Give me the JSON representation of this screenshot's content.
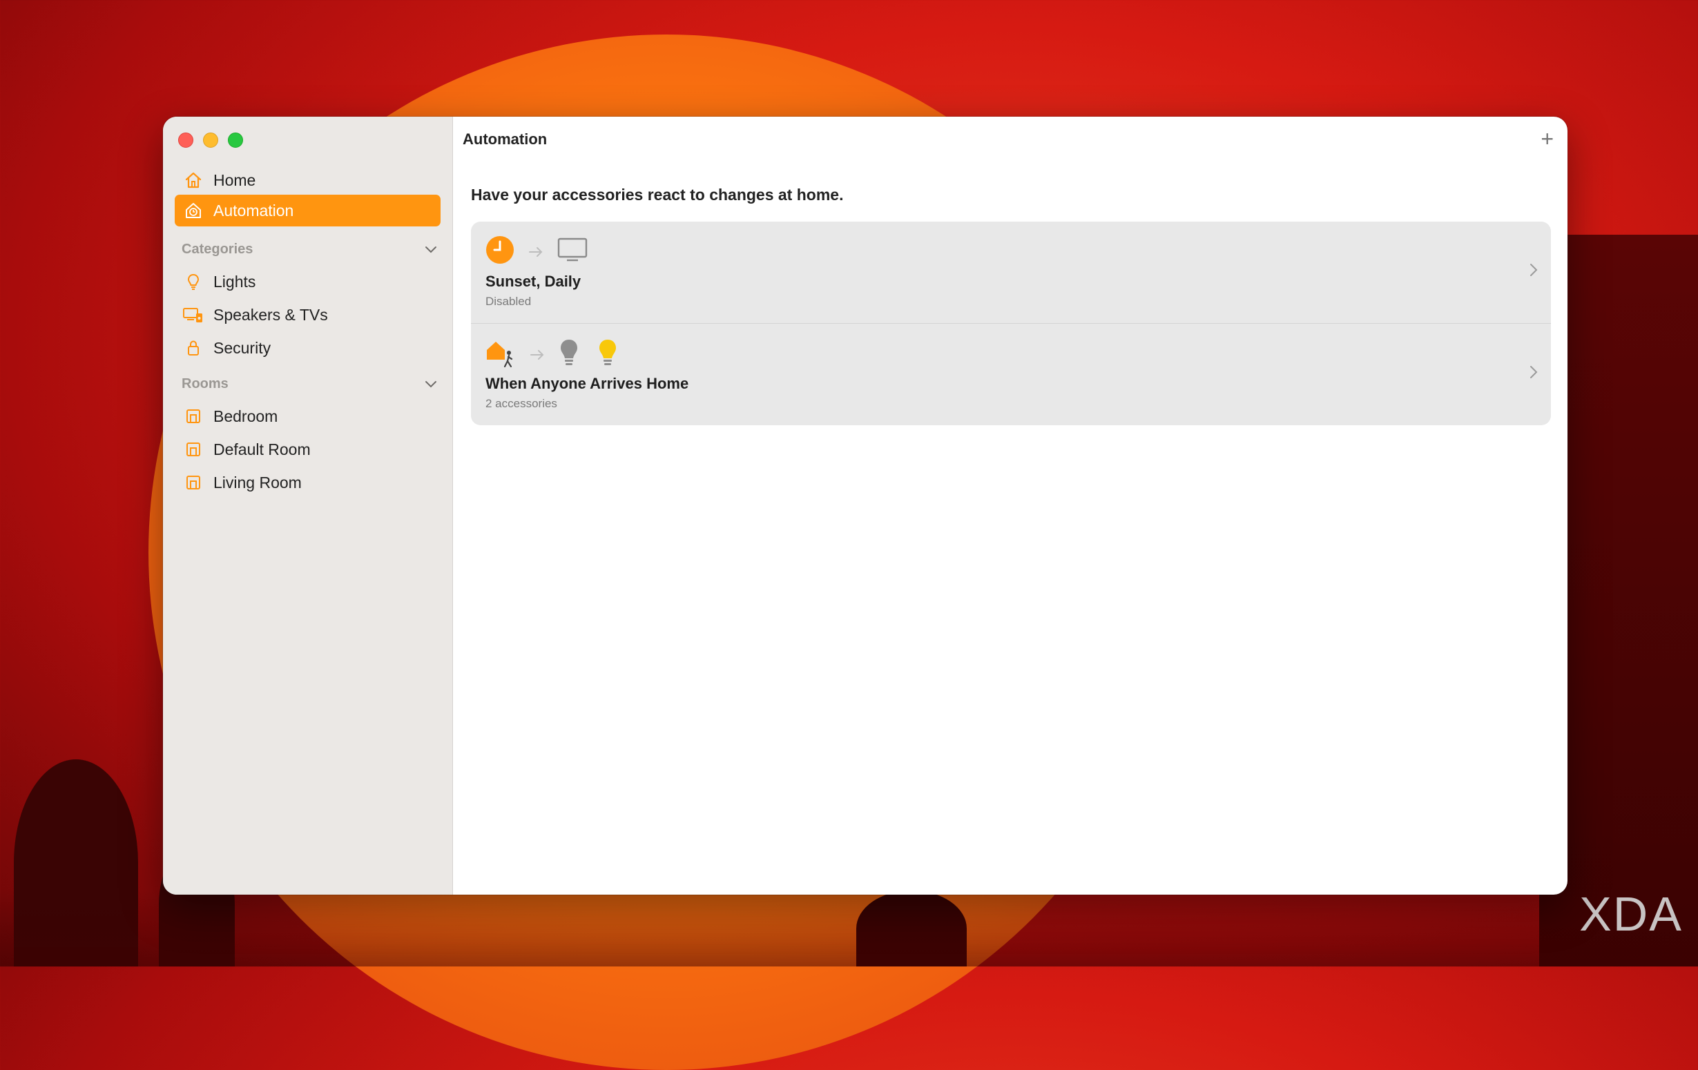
{
  "window": {
    "title": "Automation",
    "add_label": "+"
  },
  "sidebar": {
    "top_items": [
      {
        "label": "Home",
        "icon": "house-icon"
      },
      {
        "label": "Automation",
        "icon": "clock-house-icon",
        "selected": true
      }
    ],
    "categories": {
      "header": "Categories",
      "items": [
        {
          "label": "Lights",
          "icon": "lightbulb-icon"
        },
        {
          "label": "Speakers & TVs",
          "icon": "tv-speaker-icon"
        },
        {
          "label": "Security",
          "icon": "lock-icon"
        }
      ]
    },
    "rooms": {
      "header": "Rooms",
      "items": [
        {
          "label": "Bedroom",
          "icon": "room-icon"
        },
        {
          "label": "Default Room",
          "icon": "room-icon"
        },
        {
          "label": "Living Room",
          "icon": "room-icon"
        }
      ]
    }
  },
  "main": {
    "subtitle": "Have your accessories react to changes at home.",
    "automations": [
      {
        "title": "Sunset, Daily",
        "status": "Disabled",
        "trigger_icon": "clock-icon",
        "target_icons": [
          "tv-icon"
        ]
      },
      {
        "title": "When Anyone Arrives Home",
        "status": "2 accessories",
        "trigger_icon": "person-arrives-home-icon",
        "target_icons": [
          "lightbulb-off-icon",
          "lightbulb-on-icon"
        ]
      }
    ]
  },
  "watermark": "XDA",
  "colors": {
    "accent": "#ff9510",
    "sidebar_bg": "#ebe8e5",
    "card_bg": "#e8e8e8",
    "bulb_on": "#f8c80a",
    "bulb_off": "#8e8e8e"
  }
}
